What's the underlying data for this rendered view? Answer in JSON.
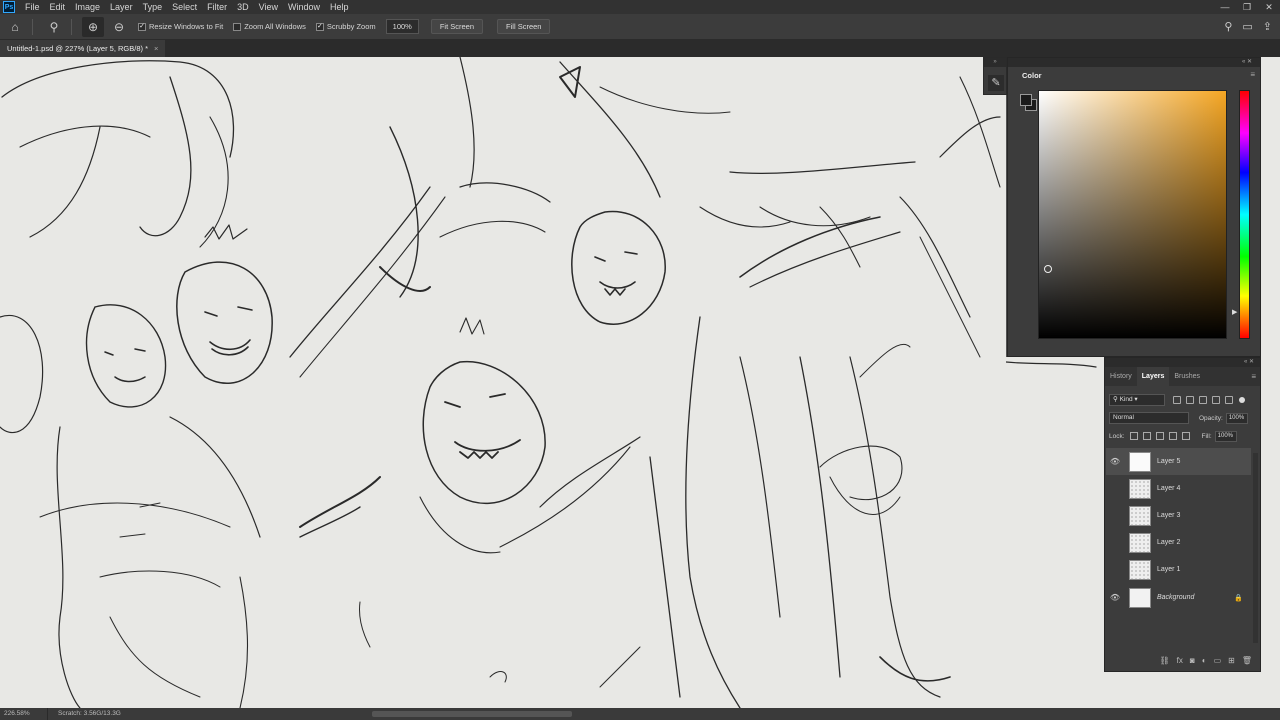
{
  "app": {
    "logo": "Ps"
  },
  "menu": [
    "File",
    "Edit",
    "Image",
    "Layer",
    "Type",
    "Select",
    "Filter",
    "3D",
    "View",
    "Window",
    "Help"
  ],
  "window_controls": {
    "minimize": "—",
    "restore": "❐",
    "close": "✕"
  },
  "options": {
    "resize_windows": {
      "label": "Resize Windows to Fit",
      "checked": true
    },
    "zoom_all": {
      "label": "Zoom All Windows",
      "checked": false
    },
    "scrubby_zoom": {
      "label": "Scrubby Zoom",
      "checked": true
    },
    "zoom_value": "100%",
    "fit_screen": "Fit Screen",
    "fill_screen": "Fill Screen"
  },
  "document": {
    "tab_title": "Untitled-1.psd @ 227% (Layer 5, RGB/8) *",
    "close": "×"
  },
  "color_panel": {
    "tab": "Color",
    "menu": "≡"
  },
  "layers_panel": {
    "tabs": [
      "History",
      "Layers",
      "Brushes"
    ],
    "active_tab": "Layers",
    "kind_filter": "Kind",
    "blend_mode": "Normal",
    "opacity_label": "Opacity:",
    "opacity": "100%",
    "lock_label": "Lock:",
    "fill_label": "Fill:",
    "fill": "100%",
    "layers": [
      {
        "name": "Layer 5",
        "visible": true,
        "selected": true
      },
      {
        "name": "Layer 4",
        "visible": false,
        "selected": false
      },
      {
        "name": "Layer 3",
        "visible": false,
        "selected": false
      },
      {
        "name": "Layer 2",
        "visible": false,
        "selected": false
      },
      {
        "name": "Layer 1",
        "visible": false,
        "selected": false
      },
      {
        "name": "Background",
        "visible": true,
        "selected": false,
        "locked": true
      }
    ]
  },
  "status": {
    "zoom": "226.58%",
    "info": "Scratch: 3.56G/13.3G"
  }
}
